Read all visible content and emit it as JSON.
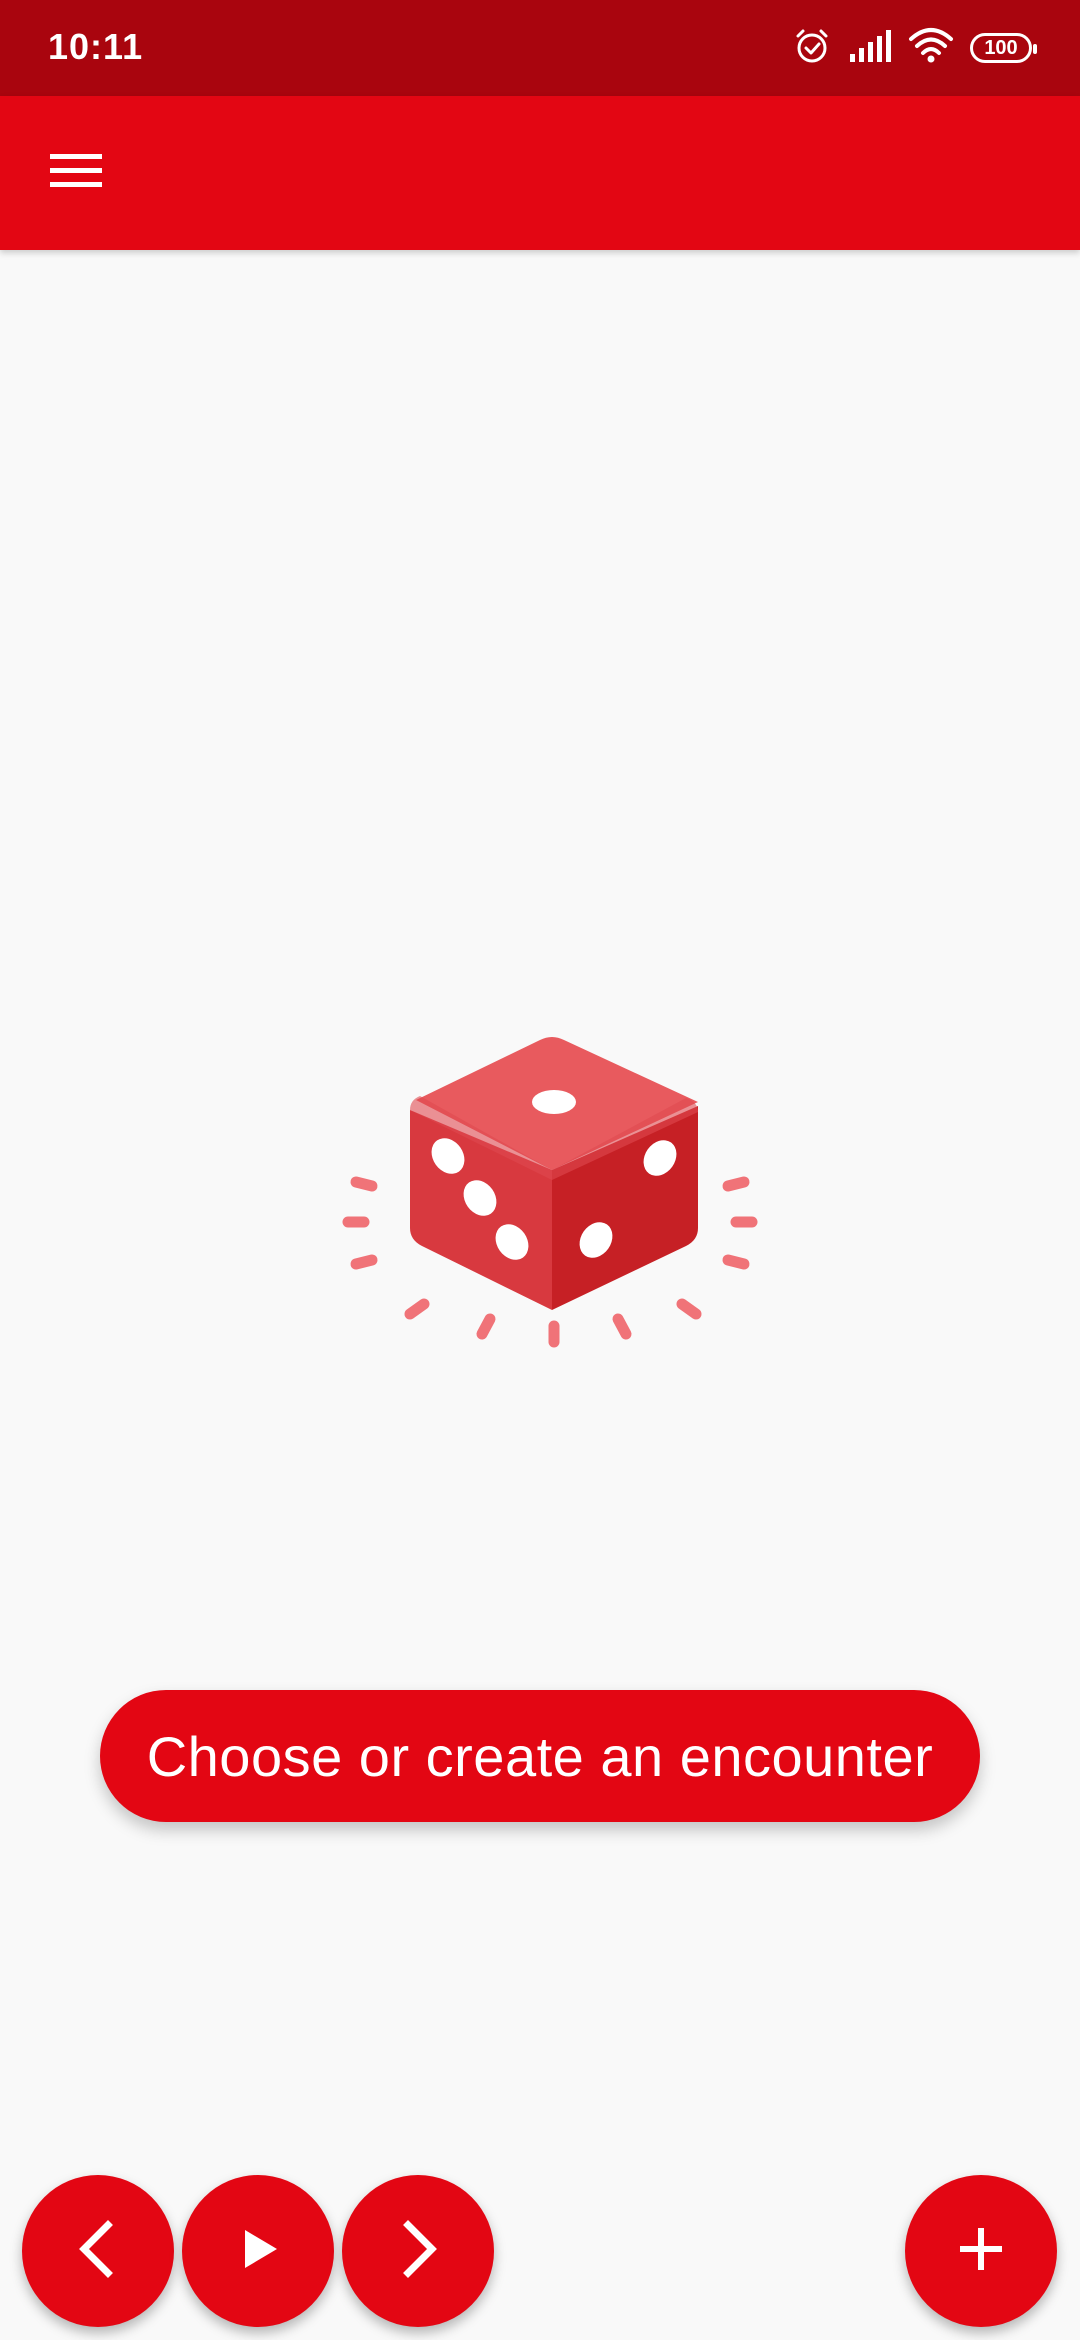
{
  "status_bar": {
    "time": "10:11",
    "battery": "100",
    "icons": [
      "alarm-icon",
      "signal-icon",
      "wifi-icon",
      "battery-icon"
    ]
  },
  "app_bar": {
    "menu_icon": "hamburger-menu-icon"
  },
  "empty_state": {
    "illustration": "dice-icon",
    "cta_label": "Choose or create an encounter"
  },
  "bottom_controls": {
    "prev_icon": "chevron-left-icon",
    "play_icon": "play-icon",
    "next_icon": "chevron-right-icon",
    "add_icon": "plus-icon"
  },
  "colors": {
    "status_bar": "#a9050e",
    "primary": "#e30613",
    "background": "#f9f9f9",
    "dice_light": "#e85a5e",
    "dice_dark": "#c62025",
    "sparkle": "#f07378"
  }
}
